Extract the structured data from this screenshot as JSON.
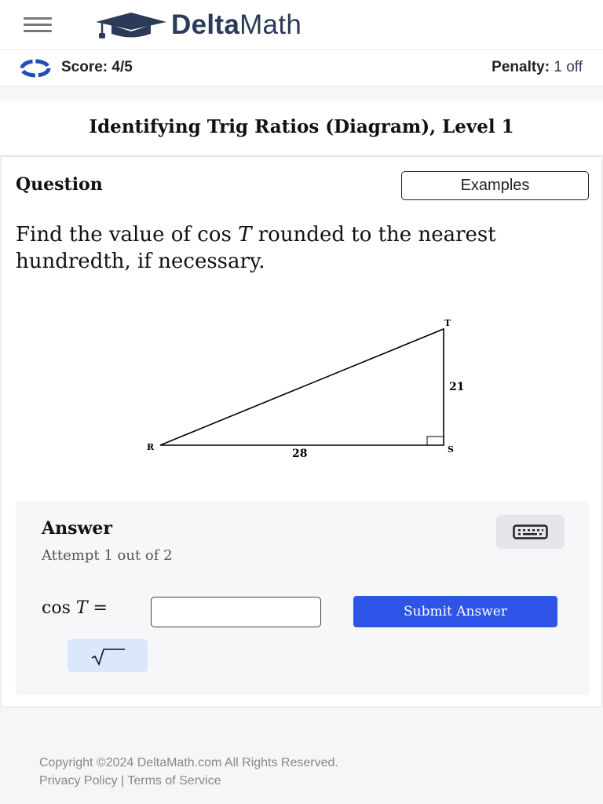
{
  "header": {
    "brand_bold": "Delta",
    "brand_regular": "Math"
  },
  "scorebar": {
    "score": "Score: 4/5",
    "penalty_label": "Penalty:",
    "penalty_value": "1 off"
  },
  "title": "Identifying Trig Ratios (Diagram), Level 1",
  "question": {
    "header": "Question",
    "examples_label": "Examples",
    "prompt_before": "Find the value of cos ",
    "prompt_var": "T",
    "prompt_after": " rounded to the nearest hundredth, if necessary."
  },
  "diagram": {
    "vertex_r": "R",
    "vertex_s": "S",
    "vertex_t": "T",
    "side_rs": "28",
    "side_st": "21"
  },
  "answer": {
    "title": "Answer",
    "attempt": "Attempt 1 out of 2",
    "eq_func": "cos ",
    "eq_var": "T",
    "eq_sign": " =",
    "input_value": "",
    "submit_label": "Submit Answer"
  },
  "footer": {
    "copyright": "Copyright ©2024 DeltaMath.com All Rights Reserved.",
    "privacy": "Privacy Policy",
    "separator": " | ",
    "terms": "Terms of Service"
  },
  "colors": {
    "brand": "#2b3a57",
    "submit": "#2f55e8",
    "score_ring": "#1f4fb5"
  },
  "icons": {
    "menu": "hamburger-menu-icon",
    "logo": "graduation-cap-icon",
    "score": "score-ring-icon",
    "keyboard": "keyboard-icon",
    "sqrt": "square-root-icon"
  }
}
